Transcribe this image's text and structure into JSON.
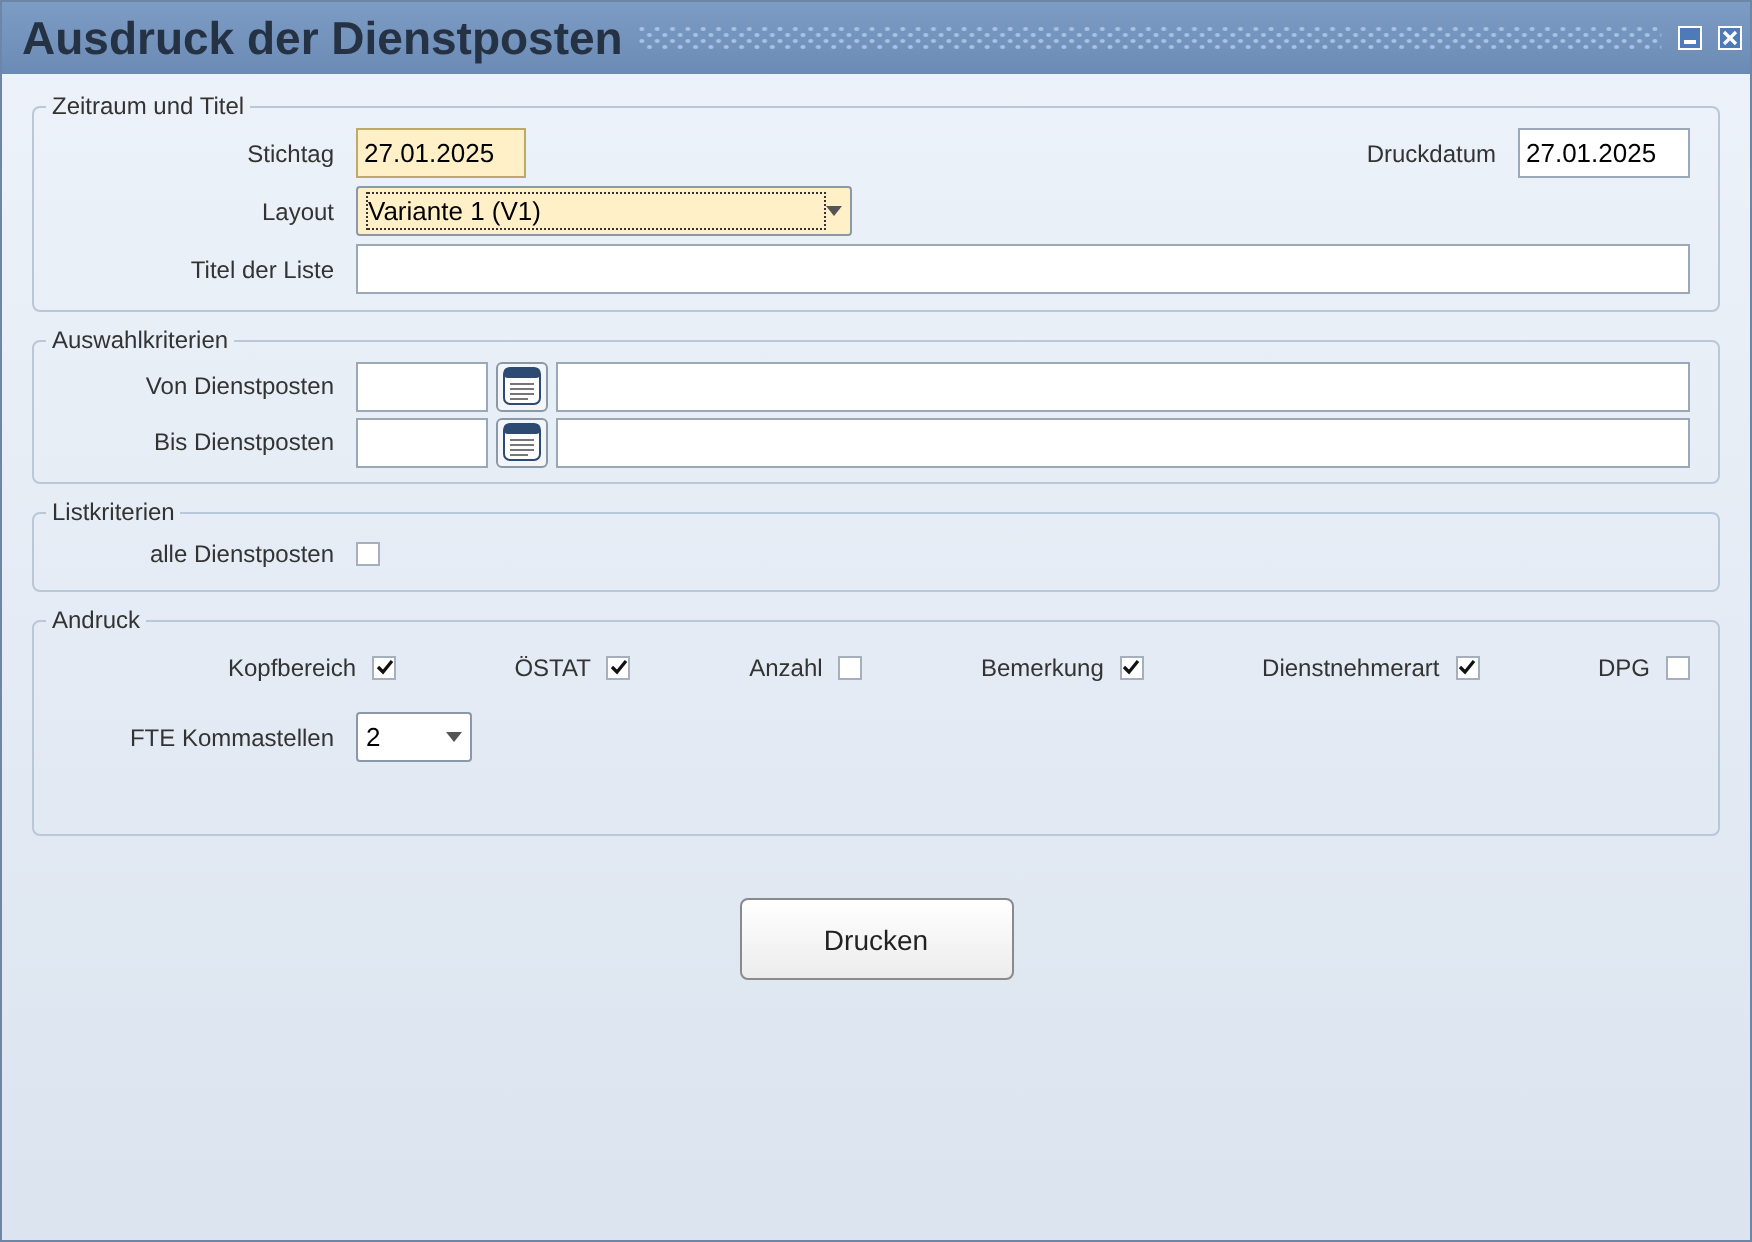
{
  "window": {
    "title": "Ausdruck der Dienstposten",
    "controls": [
      {
        "kind": "minimize"
      },
      {
        "kind": "close"
      }
    ]
  },
  "zeitraum": {
    "legend": "Zeitraum und Titel",
    "stichtag": {
      "label": "Stichtag",
      "value": "27.01.2025"
    },
    "druckdatum": {
      "label": "Druckdatum",
      "value": "27.01.2025"
    },
    "layout": {
      "label": "Layout",
      "value": "Variante 1 (V1)"
    },
    "titel": {
      "label": "Titel der Liste"
    }
  },
  "auswahl": {
    "legend": "Auswahlkriterien",
    "rows": [
      {
        "label": "Von Dienstposten"
      },
      {
        "label": "Bis Dienstposten"
      }
    ]
  },
  "listkriterien": {
    "legend": "Listkriterien",
    "option": {
      "label": "alle Dienstposten",
      "checked": false
    }
  },
  "andruck": {
    "legend": "Andruck",
    "options": [
      {
        "label": "Kopfbereich",
        "checked": true
      },
      {
        "label": "ÖSTAT",
        "checked": true
      },
      {
        "label": "Anzahl",
        "checked": false
      },
      {
        "label": "Bemerkung",
        "checked": true
      },
      {
        "label": "Dienstnehmerart",
        "checked": true
      },
      {
        "label": "DPG",
        "checked": false
      }
    ],
    "fte": {
      "label": "FTE Kommastellen",
      "value": "2"
    }
  },
  "buttons": [
    "Drucken"
  ]
}
